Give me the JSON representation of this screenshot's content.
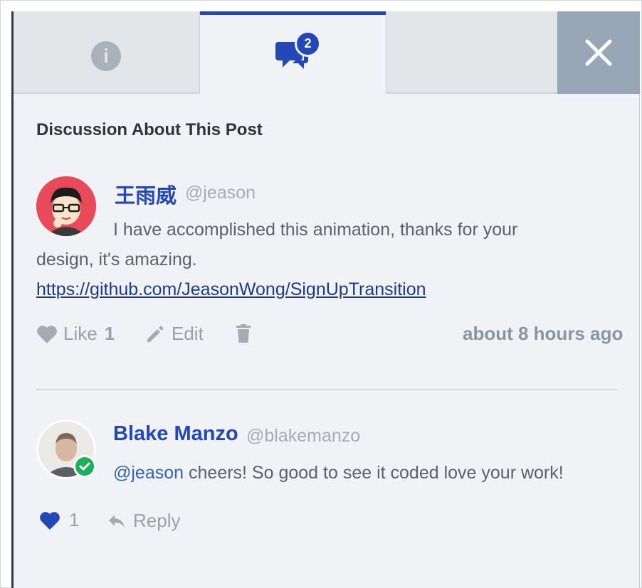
{
  "tabs": {
    "info_icon": "i",
    "discussion_badge": "2",
    "close_icon": "close-icon"
  },
  "heading": "Discussion About This Post",
  "comments": [
    {
      "name": "王雨威",
      "handle": "@jeason",
      "text_line1": "I have accomplished this animation, thanks for your",
      "text_line2": "design, it's amazing.",
      "link": "https://github.com/JeasonWong/SignUpTransition",
      "like_label": "Like",
      "like_count": "1",
      "edit_label": "Edit",
      "time": "about 8 hours ago"
    },
    {
      "name": "Blake Manzo",
      "handle": "@blakemanzo",
      "mention": "@jeason",
      "text": " cheers! So good to see it coded love your work!",
      "like_count": "1",
      "reply_label": "Reply"
    }
  ],
  "colors": {
    "accent": "#2348b5",
    "verified": "#1db05a",
    "close_bg": "#97a7b6"
  }
}
